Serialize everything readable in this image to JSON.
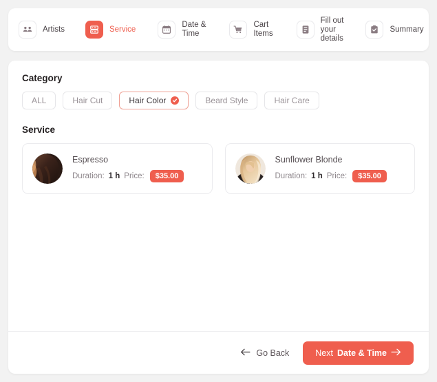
{
  "theme": {
    "accent": "#ef5e4e",
    "page_bg": "#f2f2f2",
    "card_bg": "#ffffff",
    "muted_text": "#9b9499"
  },
  "stepper": {
    "steps": [
      {
        "id": "artists",
        "label": "Artists",
        "icon": "people-icon",
        "active": false
      },
      {
        "id": "service",
        "label": "Service",
        "icon": "service-list-icon",
        "active": true
      },
      {
        "id": "date-time",
        "label": "Date &\nTime",
        "icon": "calendar-icon",
        "active": false
      },
      {
        "id": "cart-items",
        "label": "Cart\nItems",
        "icon": "cart-icon",
        "active": false
      },
      {
        "id": "details",
        "label": "Fill out\nyour\ndetails",
        "icon": "form-icon",
        "active": false
      },
      {
        "id": "summary",
        "label": "Summary",
        "icon": "clipboard-check-icon",
        "active": false
      }
    ]
  },
  "category": {
    "title": "Category",
    "pills": [
      {
        "label": "ALL",
        "selected": false
      },
      {
        "label": "Hair Cut",
        "selected": false
      },
      {
        "label": "Hair Color",
        "selected": true
      },
      {
        "label": "Beard Style",
        "selected": false
      },
      {
        "label": "Hair Care",
        "selected": false
      }
    ]
  },
  "service": {
    "title": "Service",
    "duration_label": "Duration:",
    "price_label": "Price:",
    "items": [
      {
        "name": "Espresso",
        "duration": "1 h",
        "price": "$35.00",
        "avatar": "dark-brown-hair-avatar"
      },
      {
        "name": "Sunflower Blonde",
        "duration": "1 h",
        "price": "$35.00",
        "avatar": "blonde-hair-avatar"
      }
    ]
  },
  "footer": {
    "back_label": "Go Back",
    "next_prefix": "Next",
    "next_target": "Date & Time"
  }
}
